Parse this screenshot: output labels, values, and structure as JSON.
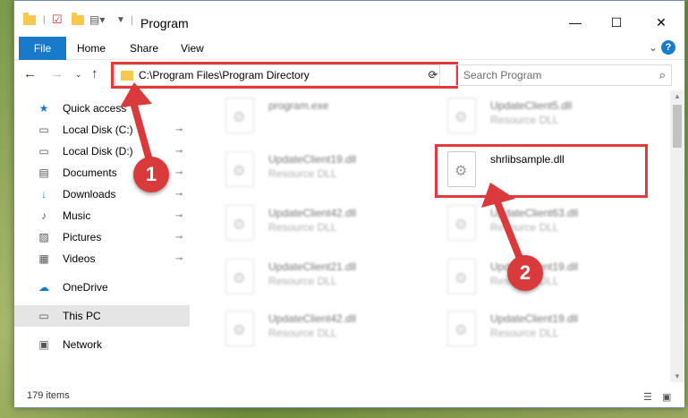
{
  "window": {
    "title": "Program",
    "minimize": "—",
    "maximize": "☐",
    "close": "✕"
  },
  "ribbon": {
    "file_tab": "File",
    "tabs": [
      "Home",
      "Share",
      "View"
    ]
  },
  "address_bar": {
    "path": "C:\\Program Files\\Program Directory",
    "refresh_icon": "⟳"
  },
  "search": {
    "placeholder": "Search Program",
    "icon": "⌕"
  },
  "sidebar": {
    "items": [
      {
        "label": "Quick access",
        "icon": "★",
        "pinned": false,
        "selected": false
      },
      {
        "label": "Local Disk (C:)",
        "icon": "▭",
        "pinned": true,
        "selected": false
      },
      {
        "label": "Local Disk (D:)",
        "icon": "▭",
        "pinned": true,
        "selected": false
      },
      {
        "label": "Documents",
        "icon": "▤",
        "pinned": true,
        "selected": false
      },
      {
        "label": "Downloads",
        "icon": "↓",
        "pinned": true,
        "selected": false
      },
      {
        "label": "Music",
        "icon": "♪",
        "pinned": true,
        "selected": false
      },
      {
        "label": "Pictures",
        "icon": "▨",
        "pinned": true,
        "selected": false
      },
      {
        "label": "Videos",
        "icon": "▦",
        "pinned": true,
        "selected": false
      },
      {
        "label": "OneDrive",
        "icon": "☁",
        "pinned": false,
        "selected": false
      },
      {
        "label": "This PC",
        "icon": "▭",
        "pinned": false,
        "selected": true
      },
      {
        "label": "Network",
        "icon": "▣",
        "pinned": false,
        "selected": false
      }
    ]
  },
  "files": [
    {
      "name": "program.exe",
      "type": "",
      "highlighted": false
    },
    {
      "name": "UpdateClient5.dll",
      "type": "Resource DLL",
      "highlighted": false
    },
    {
      "name": "UpdateClient19.dll",
      "type": "Resource DLL",
      "highlighted": false
    },
    {
      "name": "shrlibsample.dll",
      "type": "",
      "highlighted": true
    },
    {
      "name": "UpdateClient42.dll",
      "type": "Resource DLL",
      "highlighted": false
    },
    {
      "name": "UpdateClient63.dll",
      "type": "Resource DLL",
      "highlighted": false
    },
    {
      "name": "UpdateClient21.dll",
      "type": "Resource DLL",
      "highlighted": false
    },
    {
      "name": "UpdateClient19.dll",
      "type": "Resource DLL",
      "highlighted": false
    },
    {
      "name": "UpdateClient42.dll",
      "type": "Resource DLL",
      "highlighted": false
    },
    {
      "name": "UpdateClient19.dll",
      "type": "Resource DLL",
      "highlighted": false
    }
  ],
  "status_bar": {
    "item_count": "179 items"
  },
  "callouts": [
    {
      "number": "1"
    },
    {
      "number": "2"
    }
  ],
  "colors": {
    "accent": "#1979ca",
    "highlight": "#e03a3e",
    "callout": "#d93a3b",
    "folder": "#f6c94e"
  },
  "pin_icon": "📌"
}
